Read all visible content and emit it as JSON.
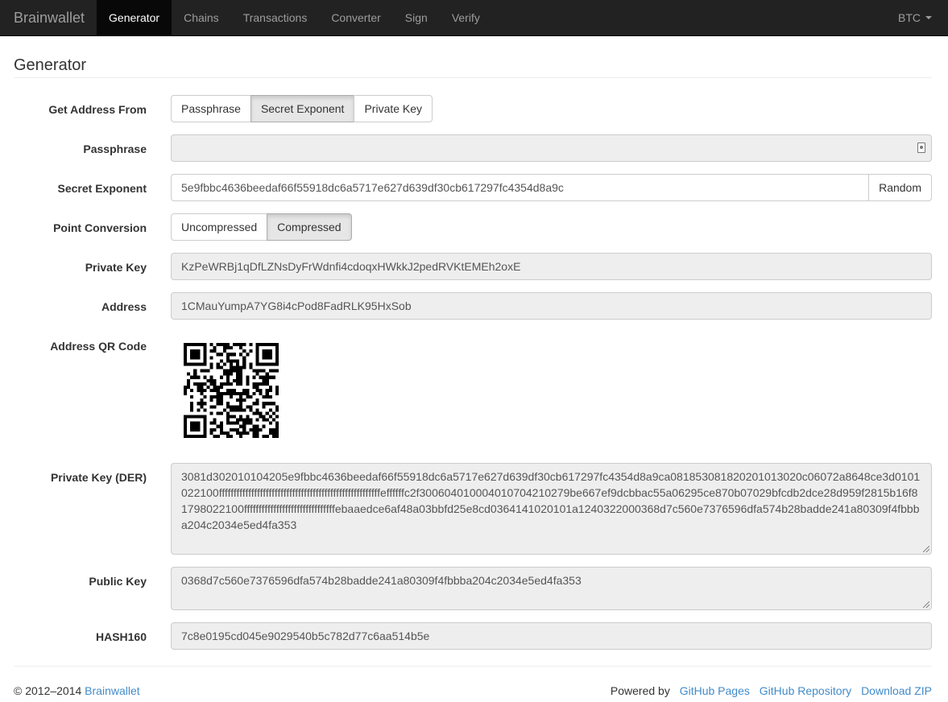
{
  "navbar": {
    "brand": "Brainwallet",
    "items": [
      {
        "label": "Generator",
        "active": true
      },
      {
        "label": "Chains"
      },
      {
        "label": "Transactions"
      },
      {
        "label": "Converter"
      },
      {
        "label": "Sign"
      },
      {
        "label": "Verify"
      }
    ],
    "currency": "BTC"
  },
  "page_title": "Generator",
  "form": {
    "get_address_from": {
      "label": "Get Address From",
      "options": [
        "Passphrase",
        "Secret Exponent",
        "Private Key"
      ],
      "selected": "Secret Exponent"
    },
    "passphrase": {
      "label": "Passphrase",
      "value": ""
    },
    "secret_exponent": {
      "label": "Secret Exponent",
      "value": "5e9fbbc4636beedaf66f55918dc6a5717e627d639df30cb617297fc4354d8a9c",
      "random_label": "Random"
    },
    "point_conversion": {
      "label": "Point Conversion",
      "options": [
        "Uncompressed",
        "Compressed"
      ],
      "selected": "Compressed"
    },
    "private_key": {
      "label": "Private Key",
      "value": "KzPeWRBj1qDfLZNsDyFrWdnfi4cdoqxHWkkJ2pedRVKtEMEh2oxE"
    },
    "address": {
      "label": "Address",
      "value": "1CMauYumpA7YG8i4cPod8FadRLK95HxSob"
    },
    "qr": {
      "label": "Address QR Code"
    },
    "der": {
      "label": "Private Key (DER)",
      "value": "3081d302010104205e9fbbc4636beedaf66f55918dc6a5717e627d639df30cb617297fc4354d8a9ca081853081820201013020c06072a8648ce3d0101022100fffffffffffffffffffffffffffffffffffffffffffffffffffffffeffffffc2f300604010004010704210279be667ef9dcbbac55a06295ce870b07029bfcdb2dce28d959f2815b16f81798022100fffffffffffffffffffffffffffffffebaaedce6af48a03bbfd25e8cd0364141020101a1240322000368d7c560e7376596dfa574b28badde241a80309f4fbbba204c2034e5ed4fa353"
    },
    "public_key": {
      "label": "Public Key",
      "value": "0368d7c560e7376596dfa574b28badde241a80309f4fbbba204c2034e5ed4fa353"
    },
    "hash160": {
      "label": "HASH160",
      "value": "7c8e0195cd045e9029540b5c782d77c6aa514b5e"
    }
  },
  "footer": {
    "copyright": "© 2012–2014 ",
    "brand_link": "Brainwallet",
    "powered_by": "Powered by",
    "links": [
      "GitHub Pages",
      "GitHub Repository",
      "Download ZIP"
    ]
  }
}
